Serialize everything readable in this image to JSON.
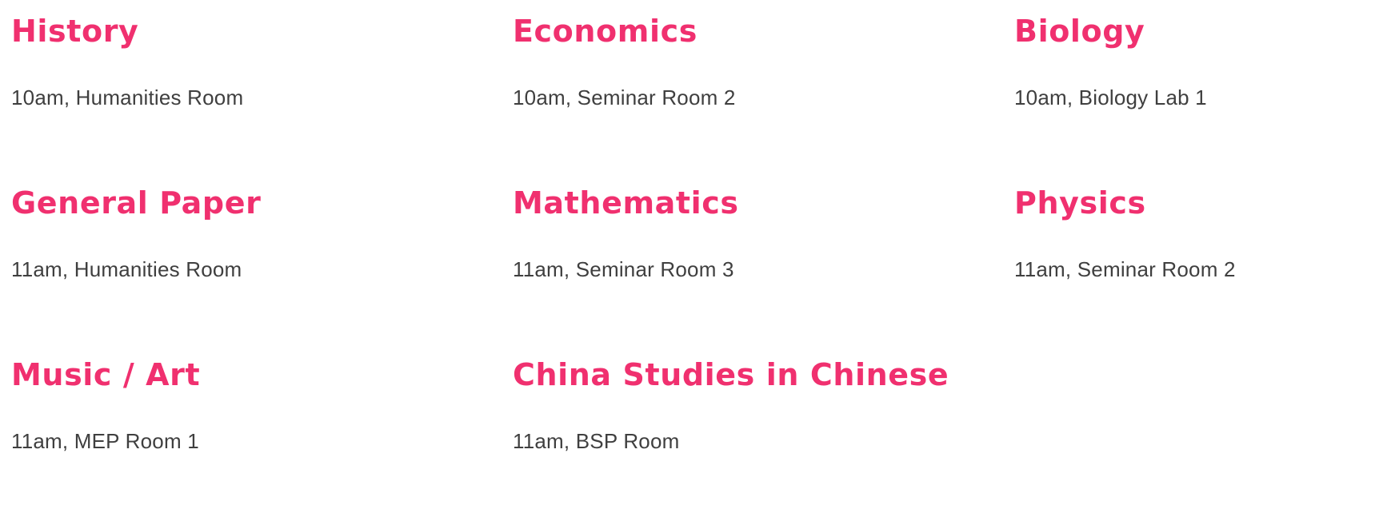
{
  "schedule": [
    {
      "title": "History",
      "details": "10am, Humanities Room"
    },
    {
      "title": "Economics",
      "details": "10am, Seminar Room 2"
    },
    {
      "title": "Biology",
      "details": "10am, Biology Lab 1"
    },
    {
      "title": "General Paper",
      "details": "11am, Humanities Room"
    },
    {
      "title": "Mathematics",
      "details": "11am, Seminar Room 3"
    },
    {
      "title": "Physics",
      "details": "11am, Seminar Room 2"
    },
    {
      "title": "Music / Art",
      "details": "11am, MEP Room 1"
    },
    {
      "title": "China Studies in Chinese",
      "details": "11am, BSP Room"
    }
  ],
  "colors": {
    "title": "#f0306f",
    "details": "#3f3f3f",
    "background": "#ffffff"
  }
}
